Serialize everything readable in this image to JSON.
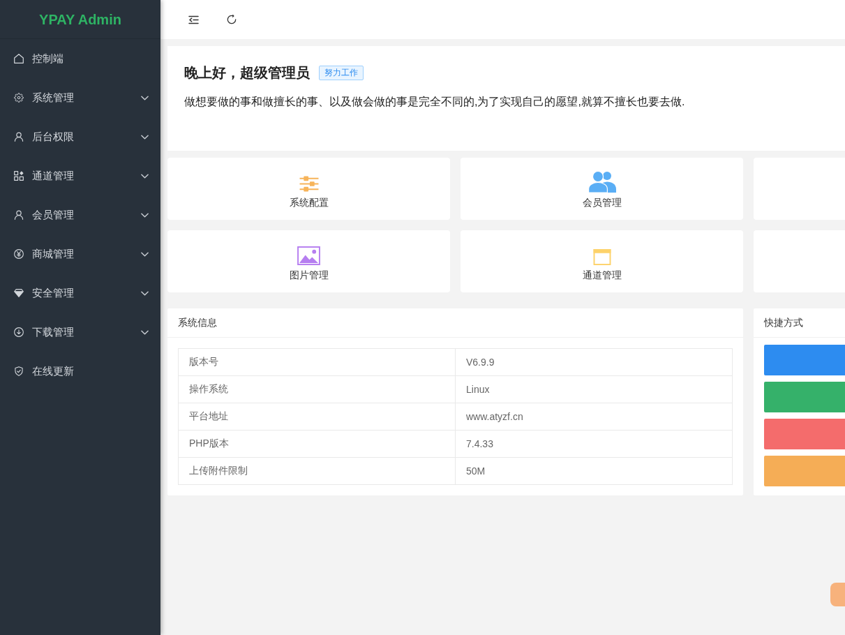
{
  "sidebar": {
    "logo": "YPAY Admin",
    "items": [
      {
        "label": "控制端",
        "kind": "link",
        "selected": false
      },
      {
        "label": "系统管理",
        "kind": "submenu",
        "expanded": false,
        "selected": false
      },
      {
        "label": "后台权限",
        "kind": "submenu",
        "expanded": false,
        "selected": false
      },
      {
        "label": "通道管理",
        "kind": "submenu",
        "expanded": false,
        "selected": false
      },
      {
        "label": "会员管理",
        "kind": "submenu",
        "expanded": false,
        "selected": false
      },
      {
        "label": "商城管理",
        "kind": "submenu",
        "expanded": false,
        "selected": false
      },
      {
        "label": "安全管理",
        "kind": "submenu",
        "expanded": false,
        "selected": false
      },
      {
        "label": "下载管理",
        "kind": "submenu",
        "expanded": false,
        "selected": false
      },
      {
        "label": "在线更新",
        "kind": "link",
        "selected": false
      }
    ]
  },
  "welcome": {
    "greeting": "晚上好，超级管理员",
    "tag": "努力工作",
    "motto": "做想要做的事和做擅长的事、以及做会做的事是完全不同的,为了实现自己的愿望,就算不擅长也要去做."
  },
  "quick_links": [
    {
      "kind": "link",
      "label": "系统配置",
      "color": "#f7b45a"
    },
    {
      "kind": "link",
      "label": "会员管理",
      "color": "#5aaef5"
    },
    {
      "kind": "blank"
    },
    {
      "kind": "link",
      "label": "图片管理",
      "color": "#b67ef0"
    },
    {
      "kind": "link",
      "label": "通道管理",
      "color": "#fdd26a"
    },
    {
      "kind": "blank"
    }
  ],
  "system_info": {
    "title": "系统信息",
    "rows": [
      {
        "label": "版本号",
        "value": "V6.9.9"
      },
      {
        "label": "操作系统",
        "value": "Linux"
      },
      {
        "label": "平台地址",
        "value": "www.atyzf.cn"
      },
      {
        "label": "PHP版本",
        "value": "7.4.33"
      },
      {
        "label": "上传附件限制",
        "value": "50M"
      }
    ]
  },
  "shortcuts": {
    "title": "快捷方式",
    "buttons": [
      {
        "color": "#2d8cf0"
      },
      {
        "color": "#35b16a"
      },
      {
        "color": "#f46c6c"
      },
      {
        "color": "#f5ad56"
      }
    ]
  }
}
